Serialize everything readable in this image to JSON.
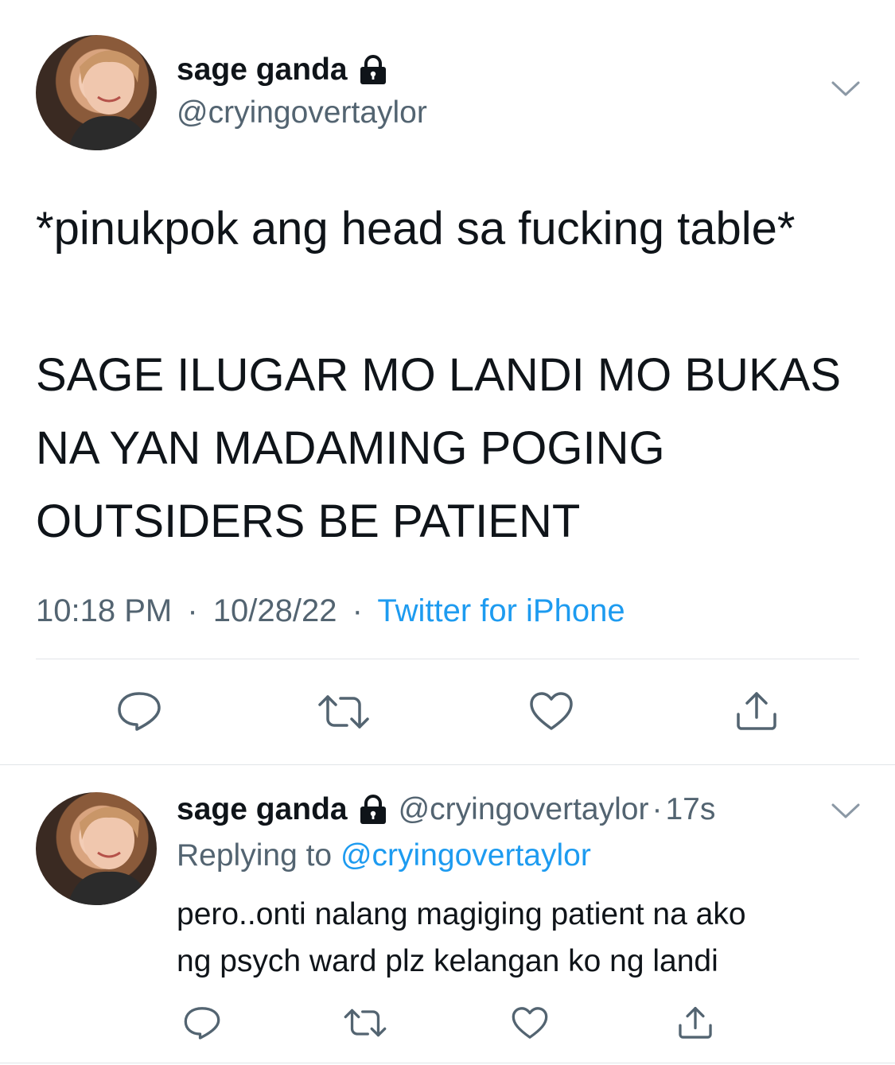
{
  "main_tweet": {
    "display_name": "sage ganda",
    "handle": "@cryingovertaylor",
    "text_lines": [
      "*pinukpok ang head sa fucking table*",
      "",
      "SAGE ILUGAR MO LANDI MO BUKAS",
      "NA YAN MADAMING POGING",
      "OUTSIDERS BE PATIENT"
    ],
    "time": "10:18 PM",
    "date": "10/28/22",
    "separator": "·",
    "source": "Twitter for iPhone",
    "icons": {
      "lock": "lock-icon",
      "more": "chevron-down-icon",
      "reply": "reply-icon",
      "retweet": "retweet-icon",
      "like": "heart-icon",
      "share": "share-icon"
    }
  },
  "reply_tweet": {
    "display_name": "sage ganda",
    "handle": "@cryingovertaylor",
    "separator": "·",
    "age": "17s",
    "replying_to_prefix": "Replying to",
    "replying_to_handle": "@cryingovertaylor",
    "text_lines": [
      "pero..onti nalang magiging patient na ako",
      "ng psych ward plz kelangan ko ng landi"
    ]
  },
  "colors": {
    "text": "#0f1419",
    "secondary": "#536471",
    "link": "#1d9bf0",
    "divider": "#e1e5e8"
  }
}
